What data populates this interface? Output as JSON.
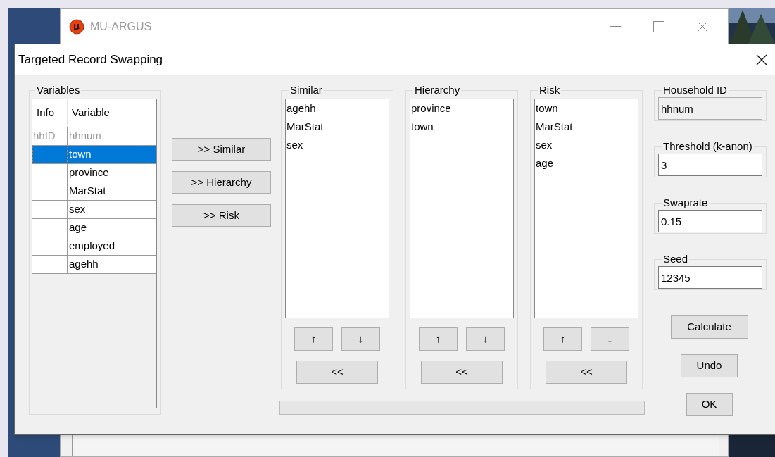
{
  "main_window": {
    "title": "MU-ARGUS"
  },
  "dialog": {
    "title": "Targeted Record Swapping",
    "variables": {
      "title": "Variables",
      "columns": [
        "Info",
        "Variable"
      ],
      "rows": [
        {
          "info": "hhID",
          "variable": "hhnum",
          "selected": false,
          "disabled": true
        },
        {
          "info": "",
          "variable": "town",
          "selected": true,
          "disabled": false
        },
        {
          "info": "",
          "variable": "province",
          "selected": false,
          "disabled": false
        },
        {
          "info": "",
          "variable": "MarStat",
          "selected": false,
          "disabled": false
        },
        {
          "info": "",
          "variable": "sex",
          "selected": false,
          "disabled": false
        },
        {
          "info": "",
          "variable": "age",
          "selected": false,
          "disabled": false
        },
        {
          "info": "",
          "variable": "employed",
          "selected": false,
          "disabled": false
        },
        {
          "info": "",
          "variable": "agehh",
          "selected": false,
          "disabled": false
        }
      ]
    },
    "add_buttons": [
      ">> Similar",
      ">> Hierarchy",
      ">> Risk"
    ],
    "lists": [
      {
        "title": "Similar",
        "items": [
          "agehh",
          "MarStat",
          "sex"
        ],
        "up": "↑",
        "down": "↓",
        "remove": "<<"
      },
      {
        "title": "Hierarchy",
        "items": [
          "province",
          "town"
        ],
        "up": "↑",
        "down": "↓",
        "remove": "<<"
      },
      {
        "title": "Risk",
        "items": [
          "town",
          "MarStat",
          "sex",
          "age"
        ],
        "up": "↑",
        "down": "↓",
        "remove": "<<"
      }
    ],
    "progress": {
      "level": 0
    },
    "fields": [
      {
        "label": "Household ID",
        "value": "hhnum",
        "disabled": true
      },
      {
        "label": "Threshold (k-anon)",
        "value": "3",
        "disabled": false
      },
      {
        "label": "Swaprate",
        "value": "0.15",
        "disabled": false
      },
      {
        "label": "Seed",
        "value": "12345",
        "disabled": false
      }
    ],
    "actions": [
      "Calculate",
      "Undo",
      "OK"
    ]
  }
}
